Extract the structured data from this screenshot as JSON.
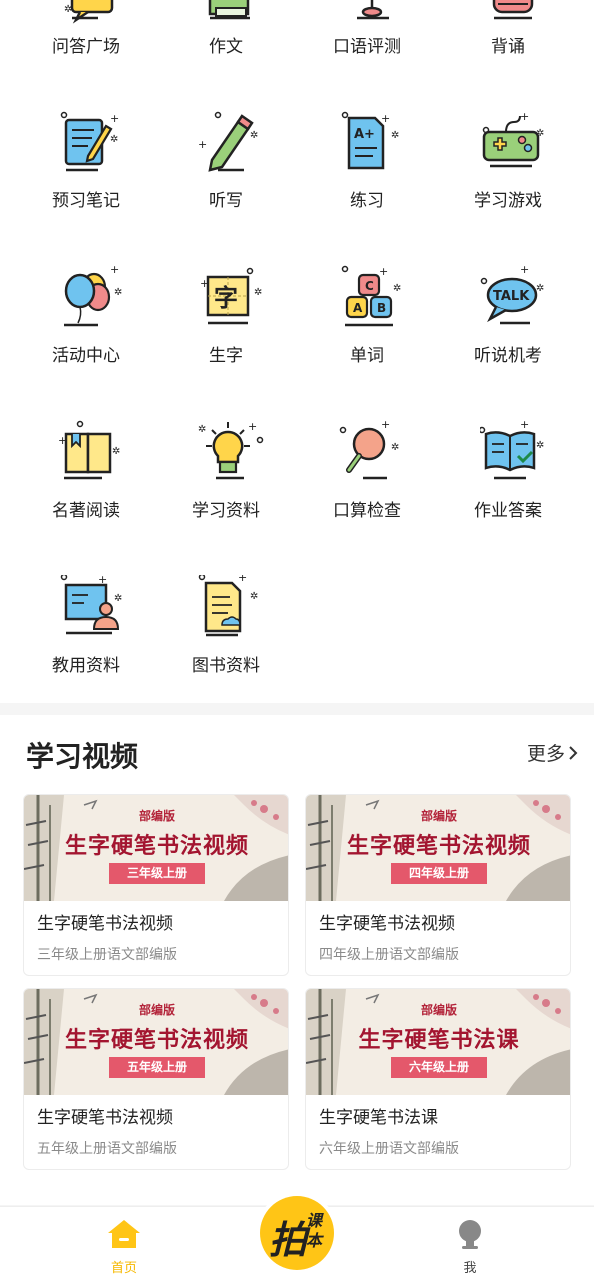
{
  "grid": [
    {
      "label": "问答广场",
      "icon": "speech-bubble-icon"
    },
    {
      "label": "作文",
      "icon": "composition-book-icon"
    },
    {
      "label": "口语评测",
      "icon": "microphone-stand-icon"
    },
    {
      "label": "背诵",
      "icon": "recite-icon"
    },
    {
      "label": "预习笔记",
      "icon": "notebook-pencil-icon"
    },
    {
      "label": "听写",
      "icon": "pencil-icon"
    },
    {
      "label": "练习",
      "icon": "graded-paper-icon"
    },
    {
      "label": "学习游戏",
      "icon": "gamepad-icon"
    },
    {
      "label": "活动中心",
      "icon": "balloons-icon"
    },
    {
      "label": "生字",
      "icon": "character-card-icon"
    },
    {
      "label": "单词",
      "icon": "abc-blocks-icon"
    },
    {
      "label": "听说机考",
      "icon": "talk-bubble-icon"
    },
    {
      "label": "名著阅读",
      "icon": "open-book-icon"
    },
    {
      "label": "学习资料",
      "icon": "lightbulb-icon"
    },
    {
      "label": "口算检查",
      "icon": "magnifier-icon"
    },
    {
      "label": "作业答案",
      "icon": "book-check-icon"
    },
    {
      "label": "教用资料",
      "icon": "teacher-board-icon"
    },
    {
      "label": "图书资料",
      "icon": "document-cloud-icon"
    }
  ],
  "icon_text": {
    "character": "字",
    "talk": "TALK",
    "a_plus": "A+",
    "a": "A",
    "b": "B",
    "c": "C"
  },
  "videos": {
    "title": "学习视频",
    "more": "更多",
    "cards": [
      {
        "edition": "部编版",
        "banner_title": "生字硬笔书法视频",
        "grade": "三年级上册",
        "title": "生字硬笔书法视频",
        "subtitle": "三年级上册语文部编版"
      },
      {
        "edition": "部编版",
        "banner_title": "生字硬笔书法视频",
        "grade": "四年级上册",
        "title": "生字硬笔书法视频",
        "subtitle": "四年级上册语文部编版"
      },
      {
        "edition": "部编版",
        "banner_title": "生字硬笔书法视频",
        "grade": "五年级上册",
        "title": "生字硬笔书法视频",
        "subtitle": "五年级上册语文部编版"
      },
      {
        "edition": "部编版",
        "banner_title": "生字硬笔书法课",
        "grade": "六年级上册",
        "title": "生字硬笔书法课",
        "subtitle": "六年级上册语文部编版"
      }
    ]
  },
  "tabbar": {
    "home": "首页",
    "center_big": "拍",
    "center_small": "课本",
    "me": "我",
    "active_color": "#f6b800",
    "inactive_color": "#444444"
  },
  "colors": {
    "accent": "#ffc516",
    "banner_red": "#a31530",
    "grade_ribbon": "#e4586b"
  }
}
